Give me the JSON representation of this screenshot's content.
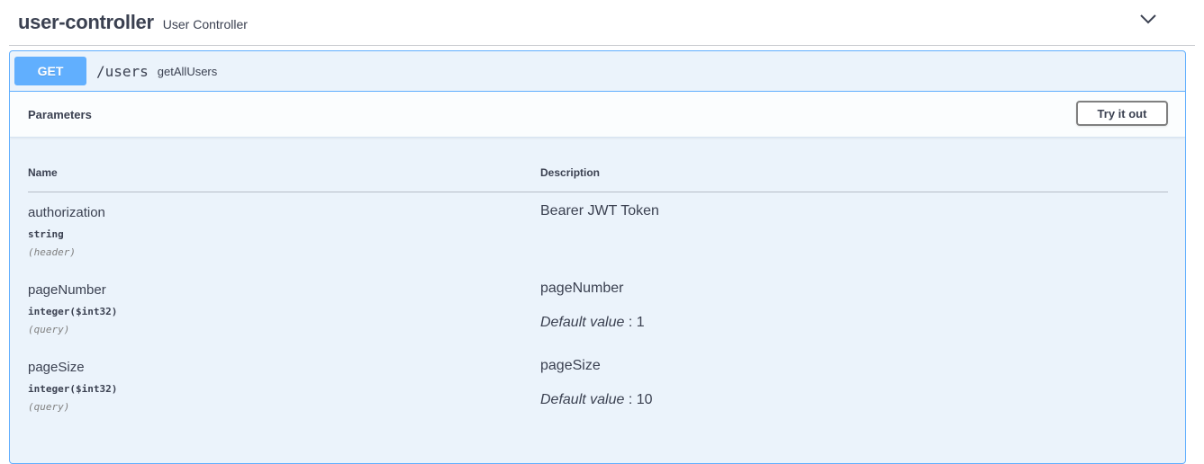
{
  "tag": {
    "name": "user-controller",
    "description": "User Controller",
    "chevron_icon": "chevron-down-icon"
  },
  "operation": {
    "method": "GET",
    "path": "/users",
    "summary": "getAllUsers",
    "method_color": "#61affe",
    "background_color": "#ebf3fb"
  },
  "parameters_section": {
    "title": "Parameters",
    "try_button_label": "Try it out",
    "name_header": "Name",
    "description_header": "Description"
  },
  "parameters": [
    {
      "name": "authorization",
      "type": "string",
      "in": "(header)",
      "description": "Bearer JWT Token",
      "default_label": "",
      "default_value": ""
    },
    {
      "name": "pageNumber",
      "type": "integer($int32)",
      "in": "(query)",
      "description": "pageNumber",
      "default_label": "Default value",
      "default_value": " : 1"
    },
    {
      "name": "pageSize",
      "type": "integer($int32)",
      "in": "(query)",
      "description": "pageSize",
      "default_label": "Default value",
      "default_value": " : 10"
    }
  ]
}
